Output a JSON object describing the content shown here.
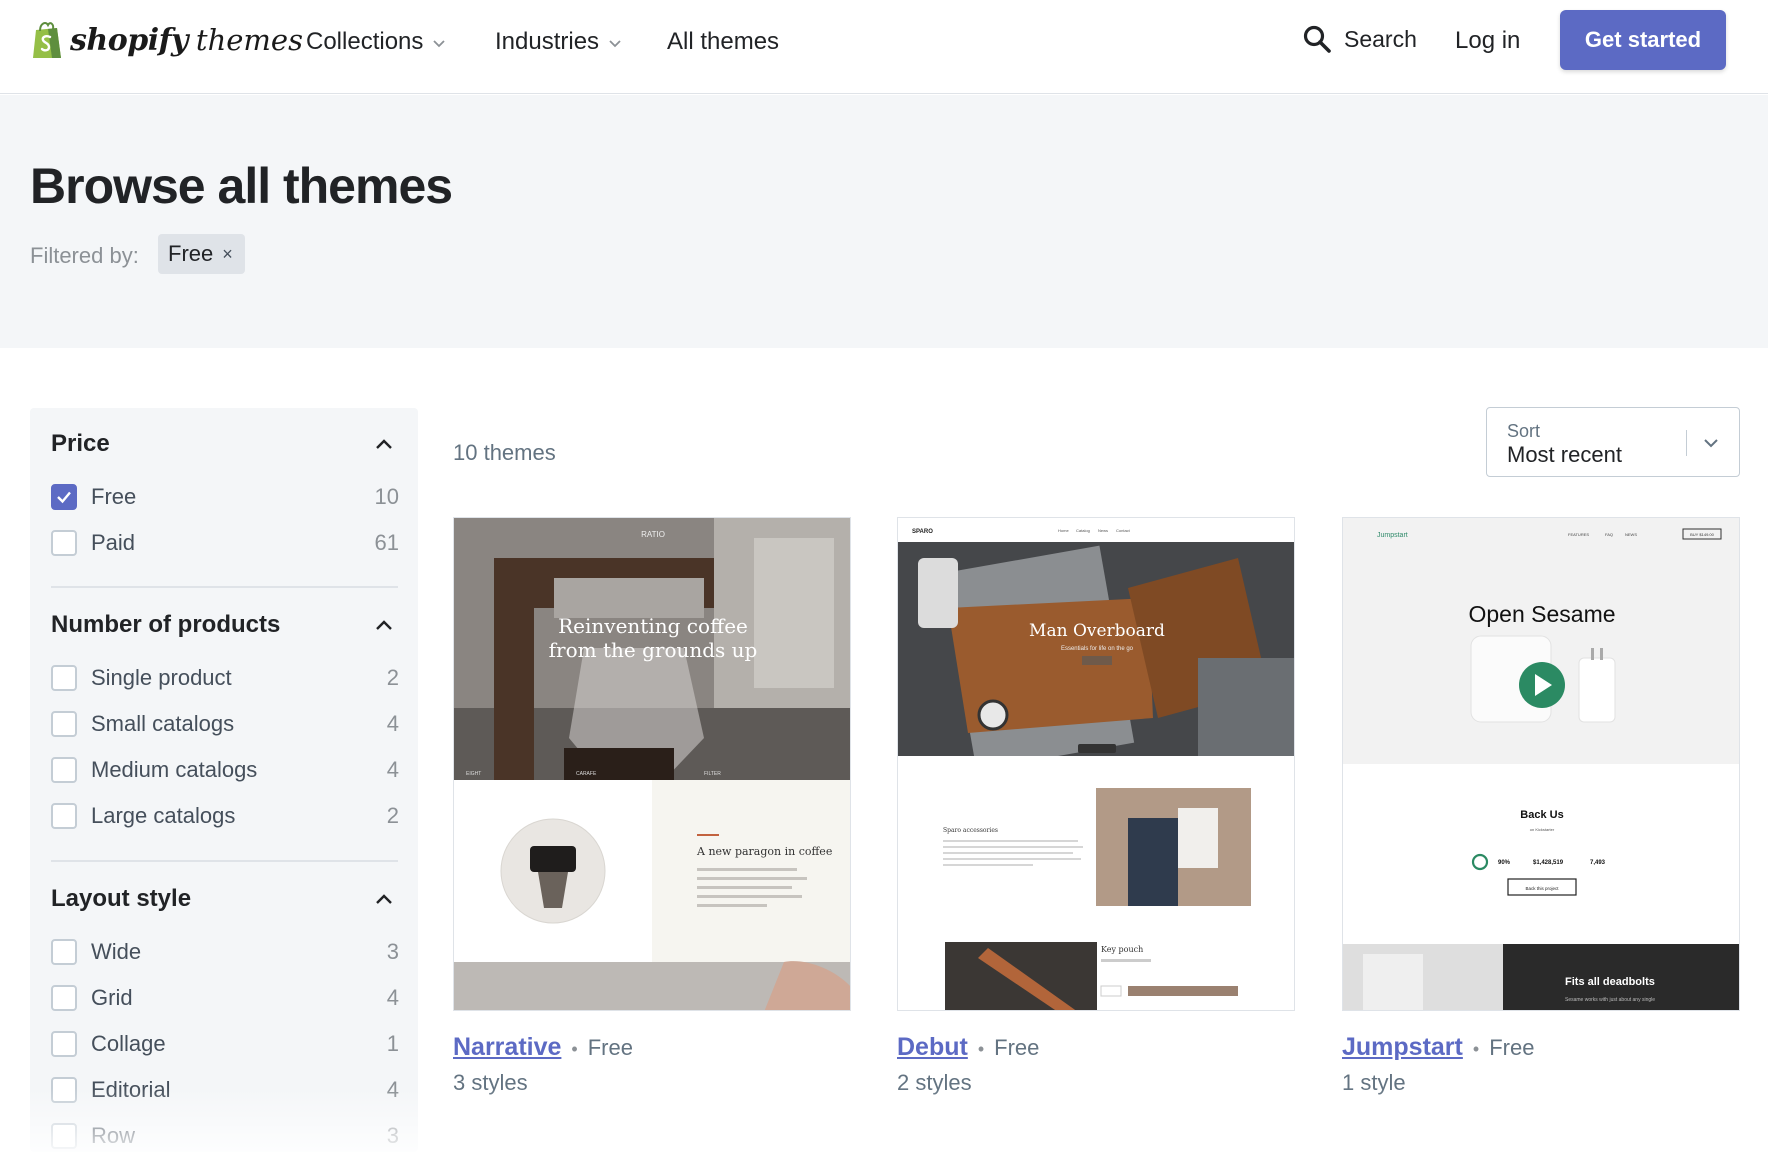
{
  "brand": {
    "name": "shopify",
    "sub": "themes"
  },
  "nav": {
    "items": [
      {
        "label": "Collections",
        "dropdown": true
      },
      {
        "label": "Industries",
        "dropdown": true
      },
      {
        "label": "All themes",
        "dropdown": false
      }
    ],
    "search_label": "Search",
    "login_label": "Log in",
    "cta_label": "Get started"
  },
  "hero": {
    "title": "Browse all themes",
    "filtered_by_label": "Filtered by:",
    "active_filter": "Free",
    "active_filter_remove": "×"
  },
  "filters": {
    "price": {
      "title": "Price",
      "options": [
        {
          "label": "Free",
          "count": "10",
          "checked": true
        },
        {
          "label": "Paid",
          "count": "61",
          "checked": false
        }
      ]
    },
    "products": {
      "title": "Number of products",
      "options": [
        {
          "label": "Single product",
          "count": "2"
        },
        {
          "label": "Small catalogs",
          "count": "4"
        },
        {
          "label": "Medium catalogs",
          "count": "4"
        },
        {
          "label": "Large catalogs",
          "count": "2"
        }
      ]
    },
    "layout": {
      "title": "Layout style",
      "options": [
        {
          "label": "Wide",
          "count": "3"
        },
        {
          "label": "Grid",
          "count": "4"
        },
        {
          "label": "Collage",
          "count": "1"
        },
        {
          "label": "Editorial",
          "count": "4"
        },
        {
          "label": "Row",
          "count": "3"
        }
      ]
    }
  },
  "results": {
    "count_label": "10 themes",
    "sort_label": "Sort",
    "sort_value": "Most recent"
  },
  "themes": [
    {
      "name": "Narrative",
      "price": "Free",
      "styles": "3 styles",
      "preview": {
        "brand": "RATIO",
        "headline_1": "Reinventing coffee",
        "headline_2": "from the grounds up",
        "subheading": "A new paragon in coffee",
        "nav_left": "EIGHT",
        "nav_mid": "CARAFE",
        "nav_right": "FILTER"
      }
    },
    {
      "name": "Debut",
      "price": "Free",
      "styles": "2 styles",
      "preview": {
        "brand": "SPARO",
        "headline": "Man Overboard",
        "tagline": "Essentials for life on the go",
        "section": "Sparo accessories",
        "product": "Key pouch",
        "nav_1": "Home",
        "nav_2": "Catalog",
        "nav_3": "News",
        "nav_4": "Contact"
      }
    },
    {
      "name": "Jumpstart",
      "price": "Free",
      "styles": "1 style",
      "preview": {
        "brand": "Jumpstart",
        "headline": "Open Sesame",
        "section": "Back Us",
        "section_sub": "on Kickstarter",
        "stat_1": "90%",
        "stat_2": "$1,428,519",
        "stat_3": "7,493",
        "button": "Back this project",
        "banner": "Fits all deadbolts",
        "banner_sub": "Sesame works with just about any single",
        "nav_1": "FEATURES",
        "nav_2": "FAQ",
        "nav_3": "NEWS",
        "buy": "BUY $149.00"
      }
    }
  ],
  "colors": {
    "accent": "#5c6ac4",
    "hero_bg": "#f4f6f8",
    "text": "#212326",
    "muted": "#637381"
  }
}
